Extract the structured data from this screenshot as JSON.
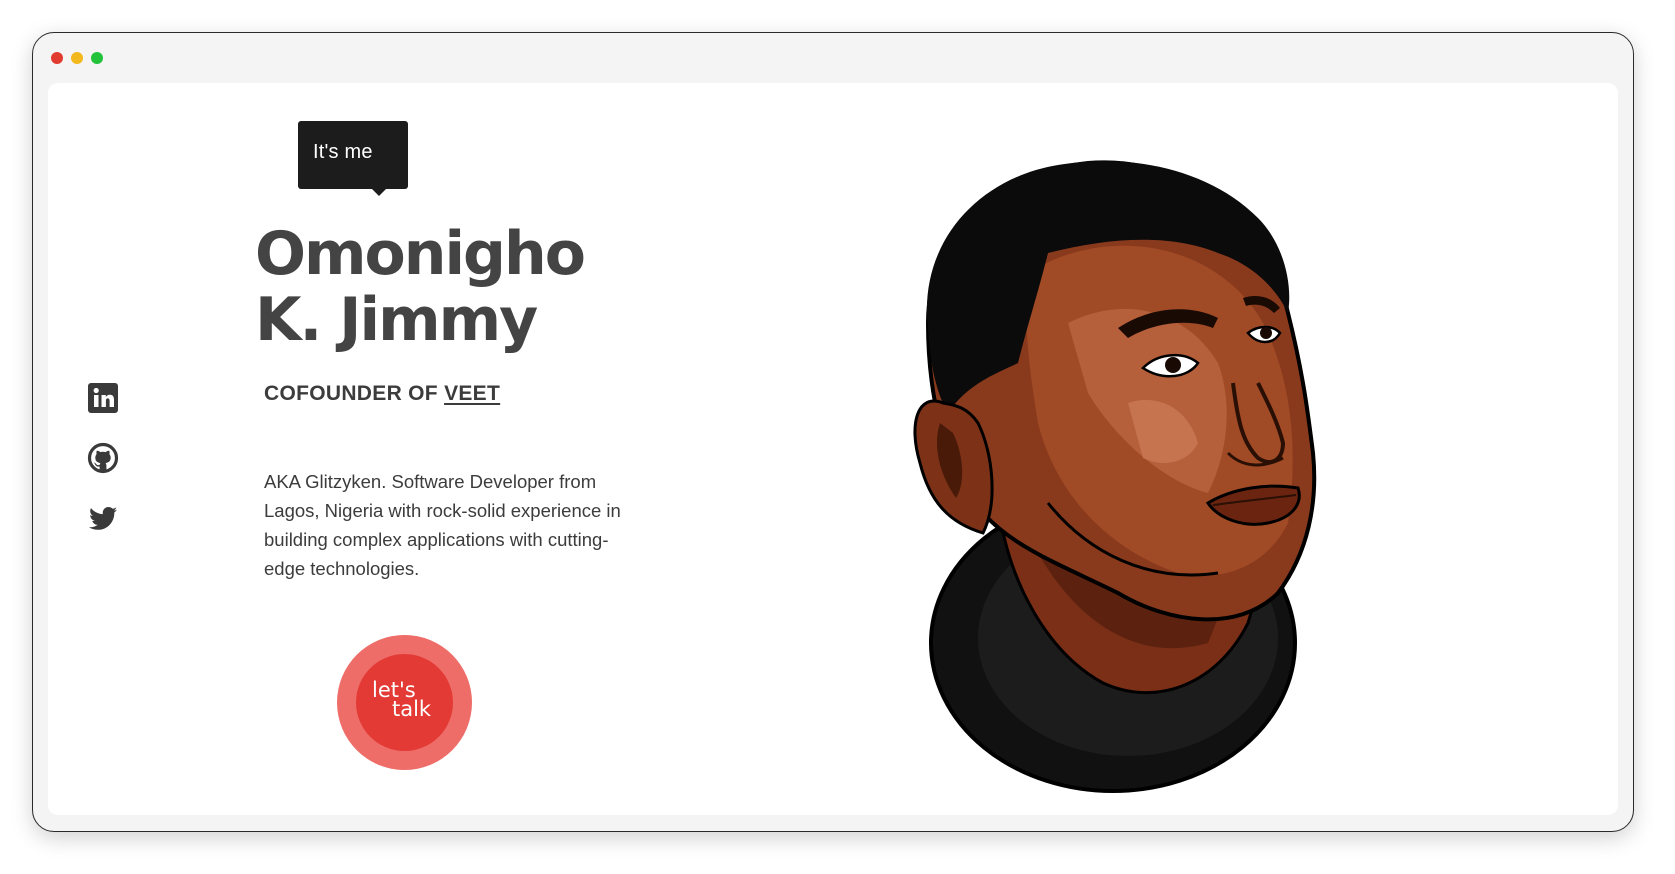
{
  "window": {
    "controls": [
      "close",
      "minimize",
      "maximize"
    ],
    "colors": {
      "close": "#e23b30",
      "minimize": "#f3b81c",
      "maximize": "#22c23a"
    }
  },
  "hero": {
    "tooltip": "It's me",
    "name_line1": "Omonigho",
    "name_line2": "K. Jimmy",
    "role_prefix": "COFOUNDER OF ",
    "role_link": "VEET",
    "bio": "AKA Glitzyken. Software Developer from Lagos, Nigeria with rock-solid experience in building complex applications with cutting-edge technologies.",
    "cta_line1": "let's",
    "cta_line2": "talk"
  },
  "social": [
    {
      "name": "linkedin",
      "icon": "linkedin-icon"
    },
    {
      "name": "github",
      "icon": "github-icon"
    },
    {
      "name": "twitter",
      "icon": "twitter-icon"
    }
  ],
  "colors": {
    "text": "#444444",
    "cta_outer": "#ee6d68",
    "cta_inner": "#e33a35",
    "tooltip_bg": "#1c1c1c"
  }
}
